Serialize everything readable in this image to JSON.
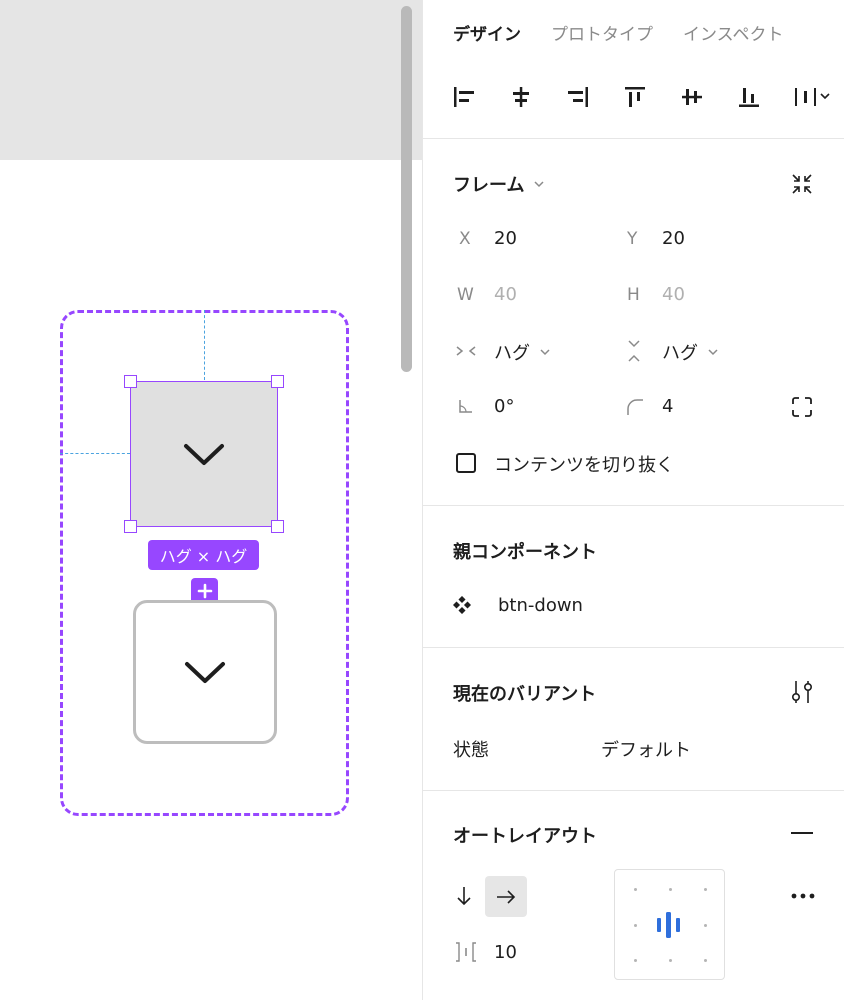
{
  "canvas": {
    "size_label": "ハグ × ハグ"
  },
  "panel": {
    "tabs": [
      {
        "label": "デザイン",
        "active": true
      },
      {
        "label": "プロトタイプ",
        "active": false
      },
      {
        "label": "インスペクト",
        "active": false
      }
    ],
    "frame": {
      "title": "フレーム",
      "x_label": "X",
      "x_value": "20",
      "y_label": "Y",
      "y_value": "20",
      "w_label": "W",
      "w_value": "40",
      "h_label": "H",
      "h_value": "40",
      "hug_h": "ハグ",
      "hug_v": "ハグ",
      "rotation": "0°",
      "radius": "4",
      "clip_label": "コンテンツを切り抜く",
      "clip_checked": false
    },
    "parent_component": {
      "title": "親コンポーネント",
      "name": "btn-down"
    },
    "variant": {
      "title": "現在のバリアント",
      "property": "状態",
      "value": "デフォルト"
    },
    "auto_layout": {
      "title": "オートレイアウト",
      "gap": "10",
      "direction": "horizontal"
    }
  },
  "colors": {
    "selection": "#9747ff",
    "guide": "#4aa3df",
    "accent_blue": "#2f6fdc"
  }
}
